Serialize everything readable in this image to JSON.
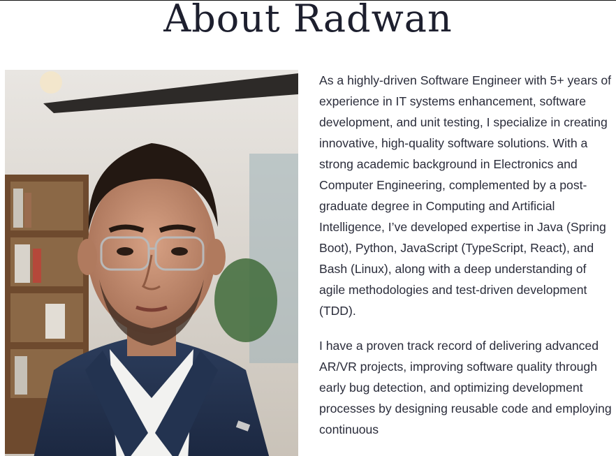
{
  "page": {
    "title": "About Radwan"
  },
  "bio": {
    "paragraphs": [
      "As a highly-driven Software Engineer with 5+ years of experience in IT systems enhancement, software development, and unit testing, I specialize in creating innovative, high-quality software solutions. With a strong academic background in Electronics and Computer Engineering, complemented by a post-graduate degree in Computing and Artificial Intelligence, I’ve developed expertise in Java (Spring Boot), Python, JavaScript (TypeScript, React), and Bash (Linux), along with a deep understanding of agile methodologies and test-driven development (TDD).",
      "I have a proven track record of delivering advanced AR/VR projects, improving software quality through early bug detection, and optimizing development processes by designing reusable code and employing continuous"
    ]
  },
  "colors": {
    "heading": "#1d1f2e",
    "body_text": "#2a2c3a",
    "background": "#ffffff"
  },
  "icons": {
    "portrait": "portrait-photo"
  }
}
